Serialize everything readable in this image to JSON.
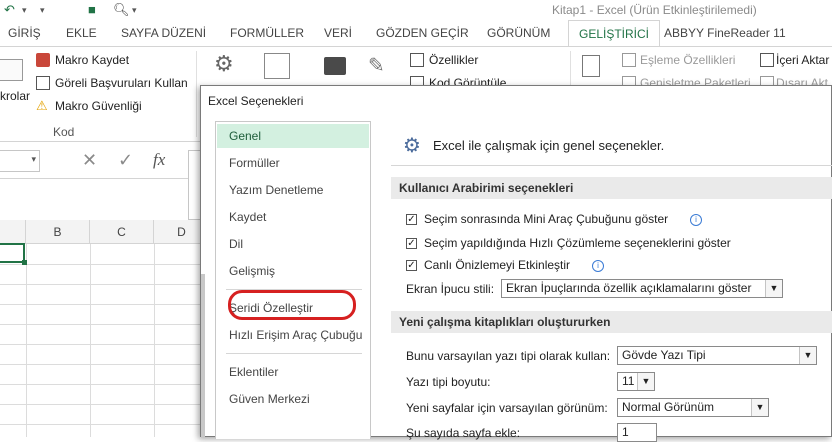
{
  "titlebar": {
    "title": "Kitap1 - Excel (Ürün Etkinleştirilemedi)"
  },
  "tabs": [
    "GİRİŞ",
    "EKLE",
    "SAYFA DÜZENİ",
    "FORMÜLLER",
    "VERİ",
    "GÖZDEN GEÇİR",
    "GÖRÜNÜM",
    "GELİŞTİRİCİ",
    "ABBYY FineReader 11"
  ],
  "active_tab": "GELİŞTİRİCİ",
  "ribbon": {
    "macros_label_fragment": "krolar",
    "record_macro": "Makro Kaydet",
    "relative_refs": "Göreli Başvuruları Kullan",
    "macro_security": "Makro Güvenliği",
    "code_group": "Kod",
    "properties": "Özellikler",
    "view_code_fragment": "Kod Görüntüle",
    "map_properties": "Eşleme Özellikleri",
    "expansion_packs_fragment": "Genişletme Paketleri",
    "import": "İçeri Aktar",
    "export_fragment": "Dışarı Akt"
  },
  "formula_bar": {
    "fx": "fx"
  },
  "grid": {
    "columns": [
      "B",
      "C",
      "D"
    ]
  },
  "dialog": {
    "title": "Excel Seçenekleri",
    "nav": [
      "Genel",
      "Formüller",
      "Yazım Denetleme",
      "Kaydet",
      "Dil",
      "Gelişmiş",
      "Şeridi Özelleştir",
      "Hızlı Erişim Araç Çubuğu",
      "Eklentiler",
      "Güven Merkezi"
    ],
    "selected_nav": "Genel",
    "highlighted_nav": "Şeridi Özelleştir",
    "header": "Excel ile çalışmak için genel seçenekler.",
    "section1": "Kullanıcı Arabirimi seçenekleri",
    "opt_mini_toolbar": "Seçim sonrasında Mini Araç Çubuğunu göster",
    "opt_quick_analysis": "Seçim yapıldığında Hızlı Çözümleme seçeneklerini göster",
    "opt_live_preview": "Canlı Önizlemeyi Etkinleştir",
    "screentip_label": "Ekran İpucu stili:",
    "screentip_value": "Ekran İpuçlarında özellik açıklamalarını göster",
    "section2": "Yeni çalışma kitaplıkları oluştururken",
    "default_font_label": "Bunu varsayılan yazı tipi olarak kullan:",
    "default_font_value": "Gövde Yazı Tipi",
    "font_size_label": "Yazı tipi boyutu:",
    "font_size_value": "11",
    "default_view_label": "Yeni sayfalar için varsayılan görünüm:",
    "default_view_value": "Normal Görünüm",
    "sheets_label_fragment": "Şu sayıda sayfa ekle:",
    "sheets_value": "1"
  },
  "colors": {
    "excel_green": "#217346",
    "nav_selected": "#d3f0e0",
    "highlight_circle": "#d62020"
  }
}
